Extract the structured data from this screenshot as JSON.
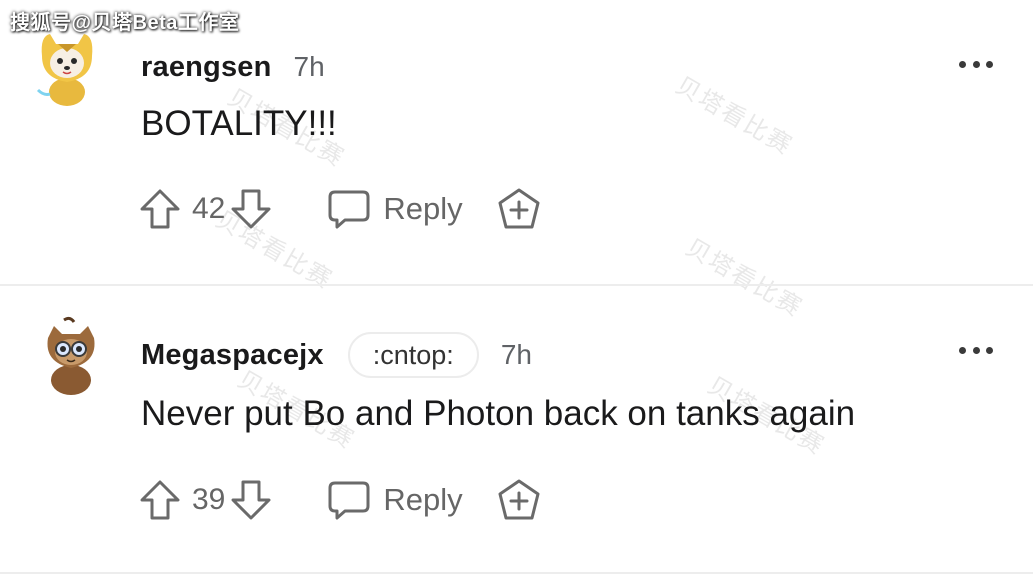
{
  "source_watermark": "搜狐号@贝塔Beta工作室",
  "overlay_watermark": "贝塔看比赛",
  "comments": [
    {
      "username": "raengsen",
      "flair": "",
      "time": "7h",
      "text": "BOTALITY!!!",
      "votes": "42",
      "reply_label": "Reply"
    },
    {
      "username": "Megaspacejx",
      "flair": ":cntop:",
      "time": "7h",
      "text": "Never put Bo and Photon back on tanks again",
      "votes": "39",
      "reply_label": "Reply"
    }
  ],
  "colors": {
    "text": "#1a1a1b",
    "muted": "#666666",
    "divider": "#ededed"
  },
  "icons": [
    "upvote-icon",
    "downvote-icon",
    "reply-bubble-icon",
    "award-icon",
    "more-options-icon"
  ]
}
